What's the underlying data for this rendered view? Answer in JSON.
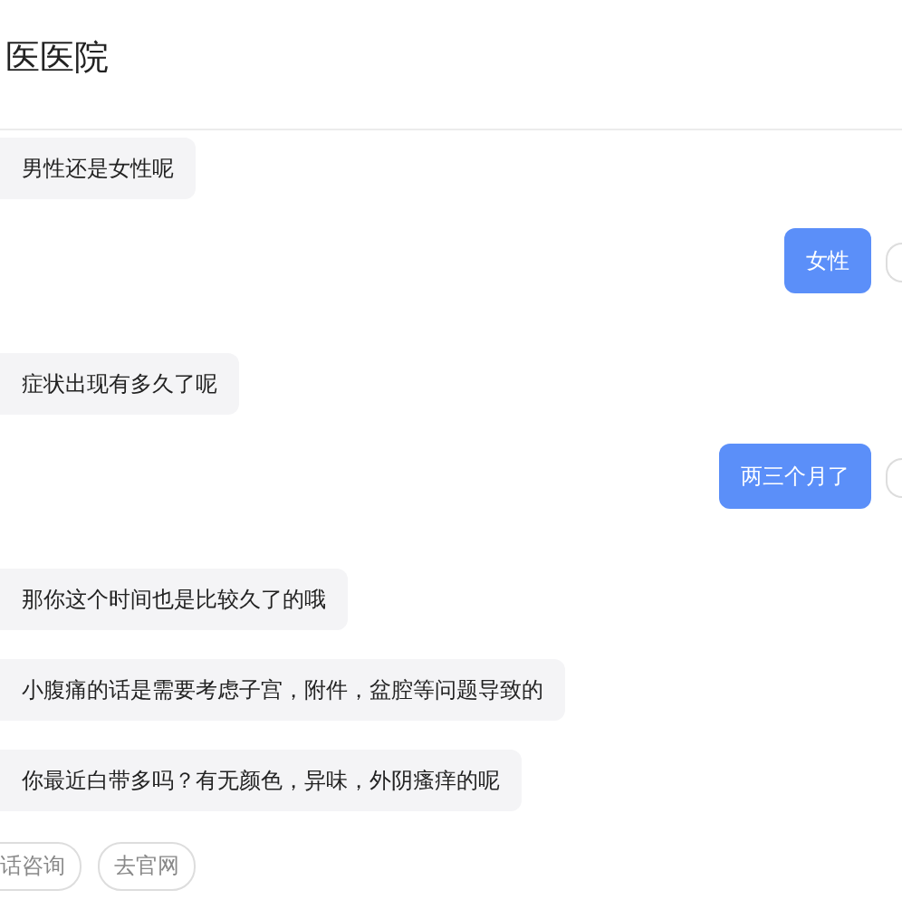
{
  "header": {
    "title": "医医院"
  },
  "messages": [
    {
      "kind": "bot",
      "text": "男性还是女性呢"
    },
    {
      "kind": "user",
      "text": "女性"
    },
    {
      "kind": "bot",
      "text": "症状出现有多久了呢"
    },
    {
      "kind": "user",
      "text": "两三个月了"
    },
    {
      "kind": "bot",
      "text": "那你这个时间也是比较久了的哦"
    },
    {
      "kind": "bot",
      "text": "小腹痛的话是需要考虑子宫，附件，盆腔等问题导致的"
    },
    {
      "kind": "bot",
      "text": "你最近白带多吗？有无颜色，异味，外阴瘙痒的呢"
    }
  ],
  "quick_replies": [
    "话咨询",
    "去官网"
  ]
}
